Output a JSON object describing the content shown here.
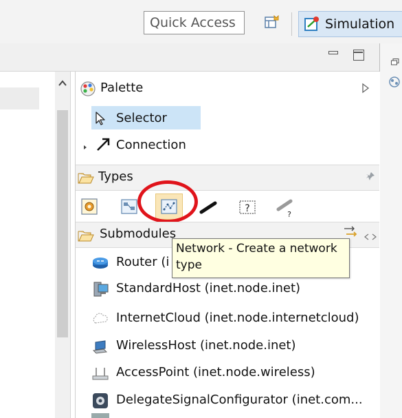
{
  "toolbar": {
    "quick_access_placeholder": "Quick Access",
    "perspective_label": "Simulation",
    "open_perspective_icon": "open-perspective-icon",
    "perspective_icon": "simulation-perspective-icon"
  },
  "palette": {
    "title": "Palette",
    "selector_label": "Selector",
    "connection_label": "Connection",
    "types": {
      "label": "Types",
      "icons": [
        "simple-module-icon",
        "compound-module-icon",
        "network-icon",
        "channel-icon",
        "interface-icon",
        "channel-interface-icon"
      ]
    },
    "submodules": {
      "label": "Submodules",
      "items": [
        {
          "label": "Router (i",
          "icon": "router-icon"
        },
        {
          "label": "StandardHost (inet.node.inet)",
          "icon": "standard-host-icon"
        },
        {
          "label": "InternetCloud (inet.node.internetcloud)",
          "icon": "internet-cloud-icon"
        },
        {
          "label": "WirelessHost (inet.node.inet)",
          "icon": "wireless-host-icon"
        },
        {
          "label": "AccessPoint (inet.node.wireless)",
          "icon": "access-point-icon"
        },
        {
          "label": "DelegateSignalConfigurator (inet.com...",
          "icon": "configurator-icon"
        }
      ]
    }
  },
  "tooltip": {
    "line1": "Network - Create a network",
    "line2": "type"
  },
  "colors": {
    "selection": "#cce4f7",
    "highlight_circle": "#e0141b",
    "tooltip_bg": "#ffffe1"
  }
}
